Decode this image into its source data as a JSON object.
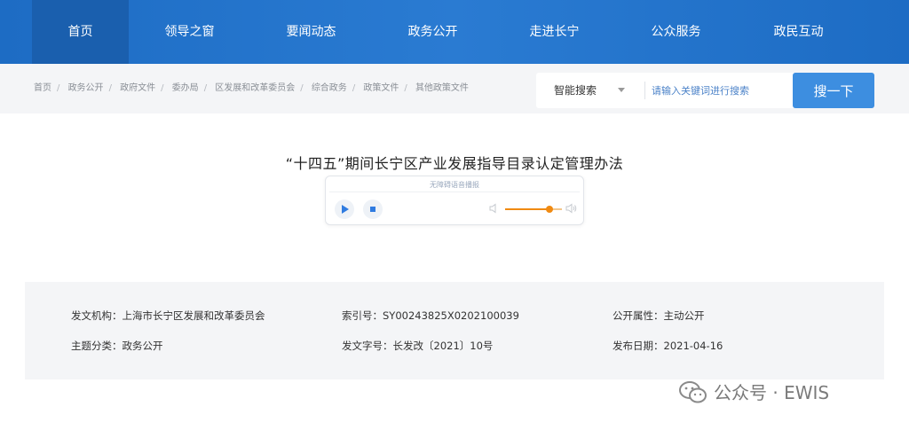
{
  "nav": {
    "items": [
      {
        "label": "首页",
        "active": true
      },
      {
        "label": "领导之窗"
      },
      {
        "label": "要闻动态"
      },
      {
        "label": "政务公开"
      },
      {
        "label": "走进长宁"
      },
      {
        "label": "公众服务"
      },
      {
        "label": "政民互动"
      }
    ]
  },
  "breadcrumb": [
    "首页",
    "政务公开",
    "政府文件",
    "委办局",
    "区发展和改革委员会",
    "综合政务",
    "政策文件",
    "其他政策文件"
  ],
  "search": {
    "scope": "智能搜索",
    "placeholder": "请输入关键词进行搜索",
    "button": "搜一下"
  },
  "article": {
    "title": "“十四五”期间长宁区产业发展指导目录认定管理办法"
  },
  "player": {
    "label": "无障碍语音播报",
    "volume": 0.78
  },
  "meta": {
    "issuer": "发文机构：上海市长宁区发展和改革委员会",
    "index": "索引号：SY00243825X0202100039",
    "publicity": "公开属性：主动公开",
    "topic": "主题分类：政务公开",
    "doc_no": "发文字号：长发改〔2021〕10号",
    "date": "发布日期：2021-04-16"
  },
  "watermark": {
    "text": "公众号 · EWIS"
  },
  "colors": {
    "nav_bg": "#1d6cc4",
    "nav_active": "#1a5fae",
    "search_button": "#3d8ee0",
    "volume": "#f08a12"
  }
}
